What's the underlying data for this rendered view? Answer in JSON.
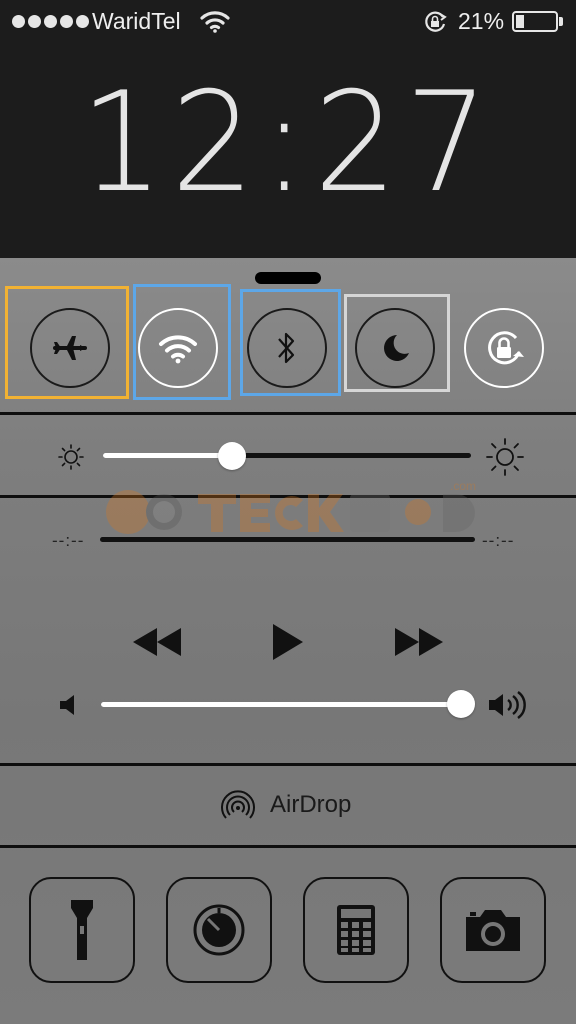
{
  "status_bar": {
    "carrier": "WaridTel",
    "battery_percent": "21%",
    "battery_level": 0.21,
    "signal_bars": 5
  },
  "lock_screen": {
    "time": "12:27"
  },
  "toggles": [
    {
      "name": "airplane-mode",
      "icon": "airplane-icon",
      "state": "off"
    },
    {
      "name": "wifi",
      "icon": "wifi-icon",
      "state": "on"
    },
    {
      "name": "bluetooth",
      "icon": "bluetooth-icon",
      "state": "off"
    },
    {
      "name": "do-not-disturb",
      "icon": "moon-icon",
      "state": "off"
    },
    {
      "name": "rotation-lock",
      "icon": "rotation-lock-icon",
      "state": "on"
    }
  ],
  "highlight_colors": {
    "airplane": "#f2b233",
    "wifi": "#5da7e8",
    "bluetooth": "#5da7e8",
    "dnd": "#d0d0d0"
  },
  "brightness": {
    "level": 0.35
  },
  "music": {
    "elapsed": "--:--",
    "remaining": "--:--",
    "volume": 1.0
  },
  "airdrop": {
    "label": "AirDrop"
  },
  "watermark": {
    "text": "TECKGURED",
    "suffix": ".com"
  },
  "shortcuts": [
    {
      "name": "flashlight",
      "icon": "flashlight-icon"
    },
    {
      "name": "timer",
      "icon": "timer-icon"
    },
    {
      "name": "calculator",
      "icon": "calculator-icon"
    },
    {
      "name": "camera",
      "icon": "camera-icon"
    }
  ]
}
